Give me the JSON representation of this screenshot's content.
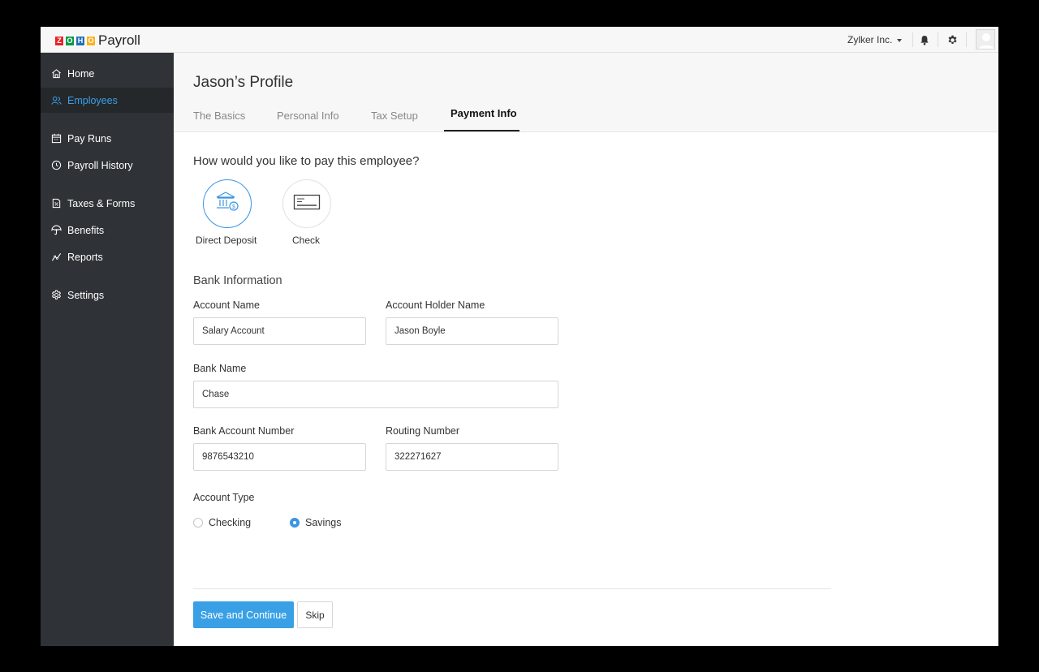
{
  "header": {
    "logo_letters": [
      "Z",
      "O",
      "H",
      "O"
    ],
    "app_name": "Payroll",
    "org_name": "Zylker Inc.",
    "icons": [
      "bell-icon",
      "gear-icon",
      "avatar"
    ]
  },
  "sidebar": {
    "items": [
      {
        "label": "Home",
        "icon": "home-icon"
      },
      {
        "label": "Employees",
        "icon": "users-icon",
        "active": true
      },
      {
        "label": "Pay Runs",
        "icon": "calendar-icon"
      },
      {
        "label": "Payroll History",
        "icon": "history-icon"
      },
      {
        "label": "Taxes & Forms",
        "icon": "tax-form-icon"
      },
      {
        "label": "Benefits",
        "icon": "umbrella-icon"
      },
      {
        "label": "Reports",
        "icon": "chart-line-icon"
      },
      {
        "label": "Settings",
        "icon": "gear-icon"
      }
    ]
  },
  "profile": {
    "title": "Jason’s Profile",
    "tabs": [
      {
        "label": "The Basics"
      },
      {
        "label": "Personal Info"
      },
      {
        "label": "Tax Setup"
      },
      {
        "label": "Payment Info",
        "active": true
      }
    ]
  },
  "payment": {
    "question": "How would you like to pay this employee?",
    "options": [
      {
        "label": "Direct Deposit",
        "icon": "bank-icon",
        "selected": true
      },
      {
        "label": "Check",
        "icon": "check-icon",
        "selected": false
      }
    ]
  },
  "bank": {
    "section_title": "Bank Information",
    "account_name": {
      "label": "Account Name",
      "value": "Salary Account"
    },
    "account_holder": {
      "label": "Account Holder Name",
      "value": "Jason Boyle"
    },
    "bank_name": {
      "label": "Bank Name",
      "value": "Chase"
    },
    "account_number": {
      "label": "Bank Account Number",
      "value": "9876543210"
    },
    "routing_number": {
      "label": "Routing Number",
      "value": "322271627"
    },
    "account_type": {
      "label": "Account Type",
      "options": [
        {
          "label": "Checking",
          "selected": false
        },
        {
          "label": "Savings",
          "selected": true
        }
      ]
    }
  },
  "actions": {
    "save_label": "Save and Continue",
    "skip_label": "Skip"
  },
  "colors": {
    "accent": "#3aa0e6",
    "sidebar_bg": "#2f3337",
    "sidebar_active_bg": "#24282b"
  }
}
